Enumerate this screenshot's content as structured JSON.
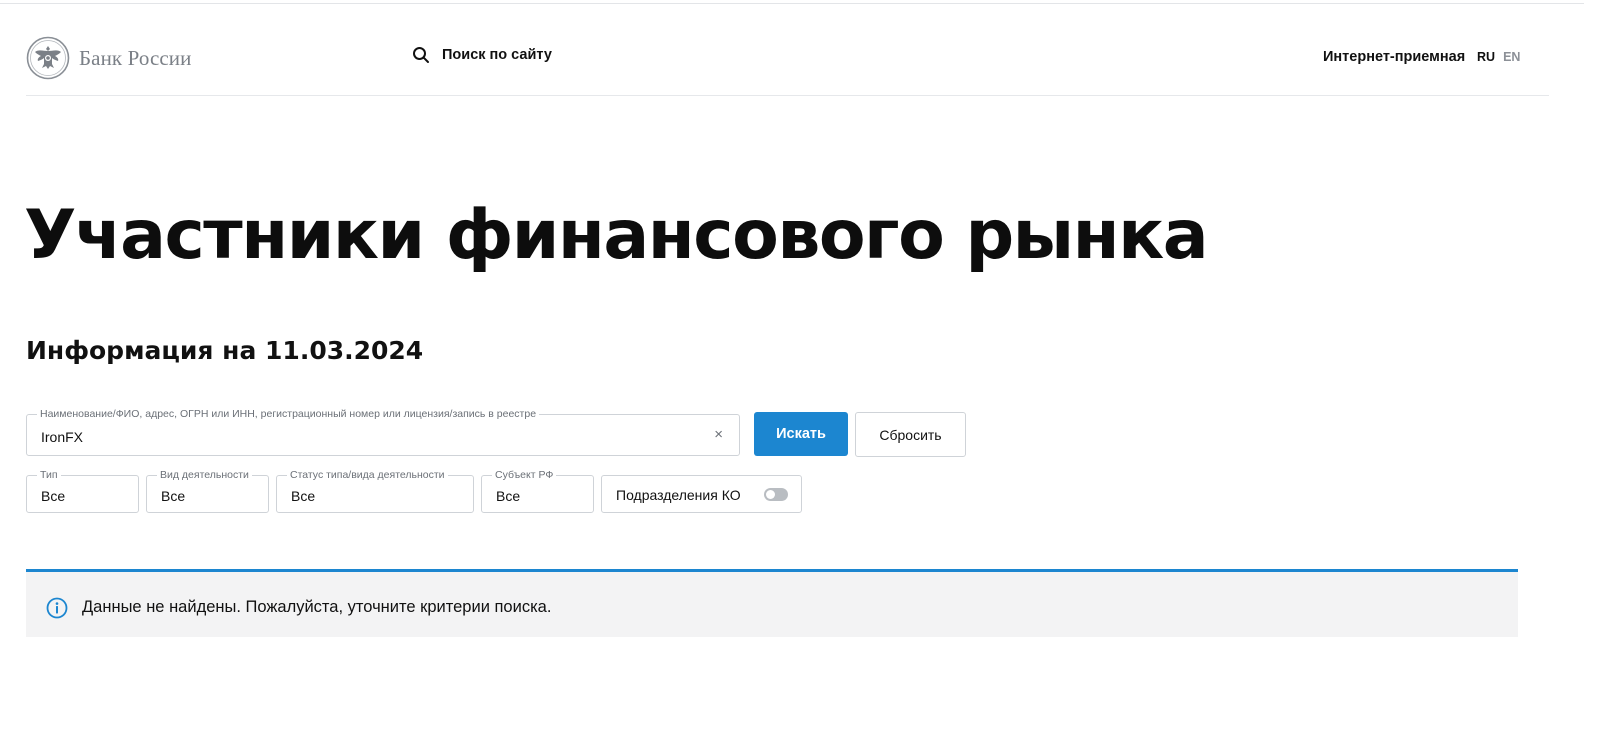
{
  "header": {
    "logo_text": "Банк России",
    "search_label": "Поиск по сайту",
    "reception_label": "Интернет-приемная",
    "lang_ru": "RU",
    "lang_en": "EN"
  },
  "page": {
    "title": "Участники финансового рынка",
    "info_date": "Информация на 11.03.2024"
  },
  "search": {
    "legend": "Наименование/ФИО, адрес, ОГРН или ИНН, регистрационный номер или лицензия/запись в реестре",
    "value": "IronFX",
    "clear_symbol": "×",
    "search_button": "Искать",
    "reset_button": "Сбросить"
  },
  "filters": {
    "type": {
      "legend": "Тип",
      "value": "Все"
    },
    "activity": {
      "legend": "Вид деятельности",
      "value": "Все"
    },
    "status": {
      "legend": "Статус типа/вида деятельности",
      "value": "Все"
    },
    "region": {
      "legend": "Субъект РФ",
      "value": "Все"
    },
    "ko_toggle": {
      "label": "Подразделения КО",
      "enabled": false
    }
  },
  "alert": {
    "text": "Данные не найдены. Пожалуйста, уточните критерии поиска.",
    "icon": "info-icon"
  },
  "colors": {
    "accent": "#1c86d0",
    "alert_bg": "#f3f3f4",
    "border": "#cfd3d8",
    "logo_text": "#7b8087"
  }
}
